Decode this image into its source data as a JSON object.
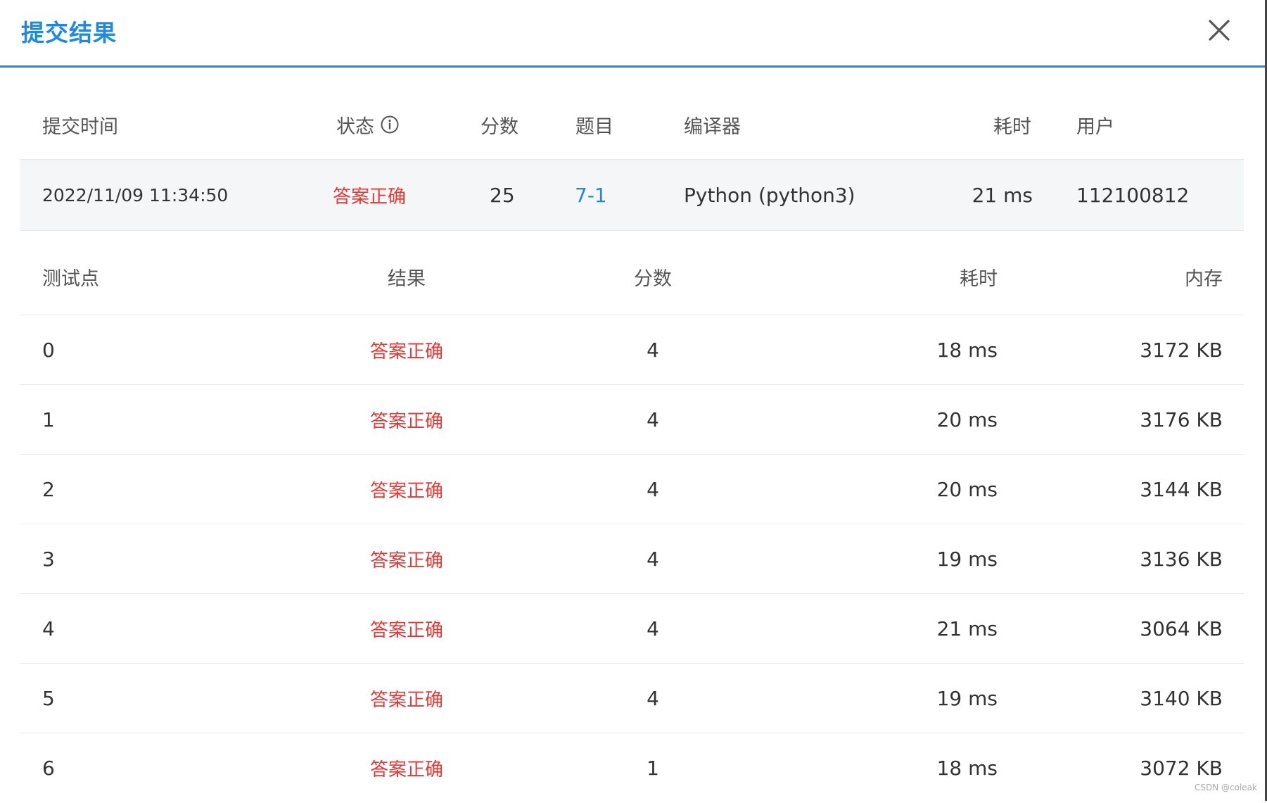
{
  "dialog": {
    "title": "提交结果",
    "close_icon": "close-icon"
  },
  "submission": {
    "headers": {
      "time": "提交时间",
      "status": "状态",
      "score": "分数",
      "problem": "题目",
      "compiler": "编译器",
      "duration": "耗时",
      "user": "用户"
    },
    "row": {
      "time": "2022/11/09 11:34:50",
      "status": "答案正确",
      "score": "25",
      "problem": "7-1",
      "compiler": "Python (python3)",
      "duration": "21 ms",
      "user": "112100812"
    }
  },
  "testpoints": {
    "headers": {
      "point": "测试点",
      "result": "结果",
      "score": "分数",
      "duration": "耗时",
      "memory": "内存"
    },
    "rows": [
      {
        "point": "0",
        "result": "答案正确",
        "score": "4",
        "duration": "18 ms",
        "memory": "3172 KB"
      },
      {
        "point": "1",
        "result": "答案正确",
        "score": "4",
        "duration": "20 ms",
        "memory": "3176 KB"
      },
      {
        "point": "2",
        "result": "答案正确",
        "score": "4",
        "duration": "20 ms",
        "memory": "3144 KB"
      },
      {
        "point": "3",
        "result": "答案正确",
        "score": "4",
        "duration": "19 ms",
        "memory": "3136 KB"
      },
      {
        "point": "4",
        "result": "答案正确",
        "score": "4",
        "duration": "21 ms",
        "memory": "3064 KB"
      },
      {
        "point": "5",
        "result": "答案正确",
        "score": "4",
        "duration": "19 ms",
        "memory": "3140 KB"
      },
      {
        "point": "6",
        "result": "答案正确",
        "score": "1",
        "duration": "18 ms",
        "memory": "3072 KB"
      }
    ]
  },
  "watermark": "CSDN @coleak",
  "colors": {
    "accent": "#1e88e5",
    "success_text": "#e53935",
    "row_highlight": "#f4f6f8"
  }
}
